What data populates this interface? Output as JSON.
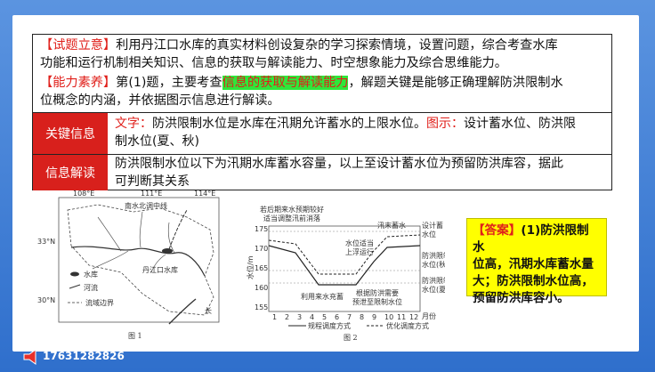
{
  "intro": {
    "tag1": "【试题立意】",
    "line1": "利用丹江口水库的真实材料创设复杂的学习探索情境，设置问题，综合考查水库",
    "line2": "功能和运行机制相关知识、信息的获取与解读能力、时空想象能力及综合思维能力。",
    "tag2": "【能力素养】",
    "line3a": "第(1)题，主要考查",
    "highlight": "信息的获取与解读能力",
    "line3b": "，解题关键是能够正确理解防洪限制水",
    "line4": "位概念的内涵，并依据图示信息进行解读。"
  },
  "key_info": {
    "label": "关键信息",
    "text_tag": "文字：",
    "text_body": "防洪限制水位是水库在汛期允许蓄水的上限水位。",
    "fig_tag": "图示：",
    "fig_body": "设计蓄水位、防洪限",
    "line2": "制水位(夏、秋)"
  },
  "interpret": {
    "label": "信息解读",
    "line1": "防洪限制水位以下为汛期水库蓄水容量，以上至设计蓄水位为预留防洪库容，据此",
    "line2": "可判断其关系"
  },
  "fig1": {
    "lon1": "108°E",
    "lon2": "111°E",
    "lon3": "114°E",
    "lat1": "33°N",
    "lat2": "30°N",
    "canal": "南水北调中线",
    "reservoir": "丹江口水库",
    "legend_res": "水库",
    "legend_river": "河流",
    "legend_border": "流域边界",
    "river_label": "长",
    "caption": "图 1"
  },
  "fig2": {
    "ann1a": "若后期来水预期较好",
    "ann1b": "适当调整汛前消落",
    "ann2a": "水位适当",
    "ann2b": "上浮运行",
    "ann3": "汛末蓄水",
    "ann4": "利用来水充蓄",
    "ann5a": "根据防洪需要",
    "ann5b": "预泄至限制水位",
    "right1a": "设计蓄",
    "right1b": "水位",
    "right2a": "防洪限制",
    "right2b": "水位(秋)",
    "right3a": "防洪限制",
    "right3b": "水位(夏)",
    "ylabel": "水位/m",
    "yticks": [
      "175",
      "170",
      "165",
      "160",
      "155"
    ],
    "xticks": [
      "1",
      "2",
      "3",
      "4",
      "5",
      "6",
      "7",
      "8",
      "9",
      "10",
      "11",
      "12"
    ],
    "xunit": "月份",
    "legend1": "规程调度方式",
    "legend2": "优化调度方式",
    "caption": "图 2"
  },
  "answer": {
    "tag": "【答案】",
    "body1": "(1)防洪限制水",
    "body2": "位高，汛期水库蓄水量",
    "body3": "大；防洪限制水位高，",
    "body4": "预留防洪库容小。"
  },
  "footer": {
    "phone": "17631282826"
  },
  "colors": {
    "accent_red": "#d8201c",
    "highlight": "#2fe63a",
    "answer_bg": "#ffff00"
  }
}
